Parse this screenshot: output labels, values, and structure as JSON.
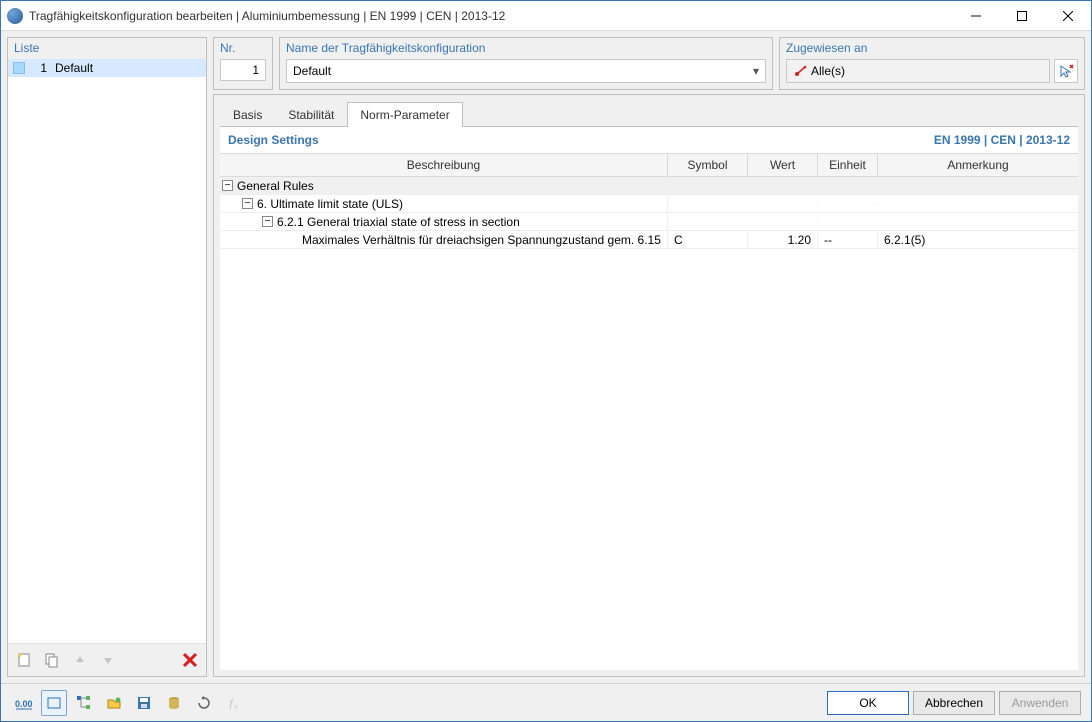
{
  "window": {
    "title": "Tragfähigkeitskonfiguration bearbeiten | Aluminiumbemessung | EN 1999 | CEN | 2013-12"
  },
  "left": {
    "label": "Liste",
    "items": [
      {
        "num": "1",
        "name": "Default"
      }
    ],
    "icons": {
      "new": "new-config-icon",
      "copy": "copy-config-icon",
      "up": "move-up-icon",
      "down": "move-down-icon",
      "delete": "delete-icon"
    }
  },
  "fields": {
    "nr_label": "Nr.",
    "nr_value": "1",
    "name_label": "Name der Tragfähigkeitskonfiguration",
    "name_value": "Default",
    "assigned_label": "Zugewiesen an",
    "assigned_value": "Alle(s)"
  },
  "tabs": {
    "items": [
      {
        "id": "basis",
        "label": "Basis",
        "active": false
      },
      {
        "id": "stab",
        "label": "Stabilität",
        "active": false
      },
      {
        "id": "norm",
        "label": "Norm-Parameter",
        "active": true
      }
    ]
  },
  "section": {
    "title": "Design Settings",
    "norm": "EN 1999 | CEN | 2013-12"
  },
  "grid": {
    "headers": {
      "desc": "Beschreibung",
      "symbol": "Symbol",
      "value": "Wert",
      "unit": "Einheit",
      "note": "Anmerkung"
    },
    "rows": [
      {
        "type": "group",
        "level": 0,
        "desc": "General Rules"
      },
      {
        "type": "group",
        "level": 1,
        "desc": "6. Ultimate limit state (ULS)"
      },
      {
        "type": "group",
        "level": 2,
        "desc": "6.2.1 General triaxial state of stress in section"
      },
      {
        "type": "leaf",
        "level": 3,
        "desc": "Maximales Verhältnis für dreiachsigen Spannungzustand gem. 6.15",
        "symbol": "C",
        "value": "1.20",
        "unit": "--",
        "note": "6.2.1(5)"
      }
    ]
  },
  "buttons": {
    "ok": "OK",
    "cancel": "Abbrechen",
    "apply": "Anwenden"
  }
}
